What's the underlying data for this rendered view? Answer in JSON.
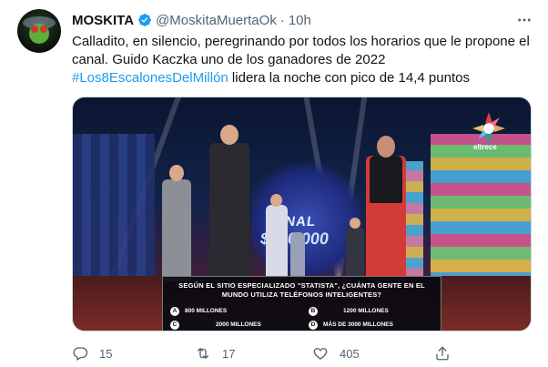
{
  "tweet": {
    "author_name": "MOSKITA",
    "handle": "@MoskitaMuertaOk",
    "separator": "·",
    "time": "10h",
    "text_line1": "Calladito, en silencio, peregrinando por todos los horarios que le propone el",
    "text_line2": "canal. Guido Kaczka uno de los ganadores de 2022",
    "hashtag": "#Los8EscalonesDelMillón",
    "text_line3_rest": " lidera la noche con pico de 14,4 puntos"
  },
  "media": {
    "channel_logo_text": "eltrece",
    "stage_sign_final": "FINAL",
    "stage_sign_amount": "$000.000",
    "question": {
      "line1": "SEGÚN EL SITIO ESPECIALIZADO \"STATISTA\", ¿CUÁNTA GENTE EN EL",
      "line2": "MUNDO UTILIZA TELÉFONOS INTELIGENTES?"
    },
    "answers": [
      {
        "letter": "A",
        "text": "800 MILLONES"
      },
      {
        "letter": "B",
        "text": "1200 MILLONES"
      },
      {
        "letter": "C",
        "text": "2000 MILLONES"
      },
      {
        "letter": "D",
        "text": "MÁS DE 3000 MILLONES"
      }
    ]
  },
  "actions": {
    "replies": "15",
    "retweets": "17",
    "likes": "405"
  },
  "icons": [
    "verified-badge-icon",
    "more-options-icon",
    "reply-icon",
    "retweet-icon",
    "like-icon",
    "share-icon"
  ],
  "colors": {
    "accent": "#1d9bf0",
    "secondary_text": "#536471",
    "primary_text": "#0f1419"
  }
}
